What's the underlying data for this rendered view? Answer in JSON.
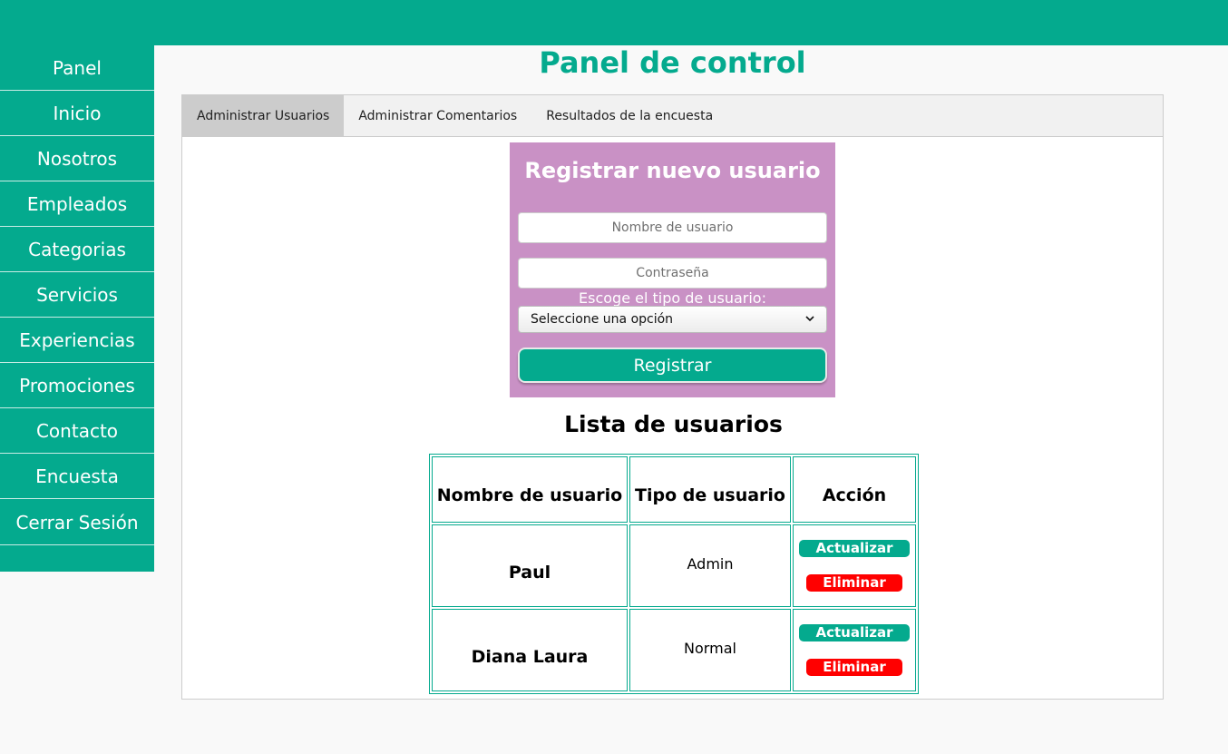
{
  "sidebar": {
    "items": [
      "Panel",
      "Inicio",
      "Nosotros",
      "Empleados",
      "Categorias",
      "Servicios",
      "Experiencias",
      "Promociones",
      "Contacto",
      "Encuesta",
      "Cerrar Sesión"
    ]
  },
  "page": {
    "title": "Panel de control"
  },
  "tabs": [
    "Administrar Usuarios",
    "Administrar Comentarios",
    "Resultados de la encuesta"
  ],
  "register": {
    "title": "Registrar nuevo usuario",
    "username_placeholder": "Nombre de usuario",
    "password_placeholder": "Contraseña",
    "type_label": "Escoge el tipo de usuario:",
    "type_select": "Seleccione una opción",
    "submit_label": "Registrar"
  },
  "users": {
    "title": "Lista de usuarios",
    "headers": [
      "Nombre de usuario",
      "Tipo de usuario",
      "Acción"
    ],
    "rows": [
      {
        "name": "Paul",
        "type": "Admin"
      },
      {
        "name": "Diana Laura",
        "type": "Normal"
      }
    ],
    "update_label": "Actualizar",
    "delete_label": "Eliminar"
  },
  "colors": {
    "accent": "#04aa8e",
    "form_bg": "#c991c5",
    "danger": "#ff0000"
  }
}
